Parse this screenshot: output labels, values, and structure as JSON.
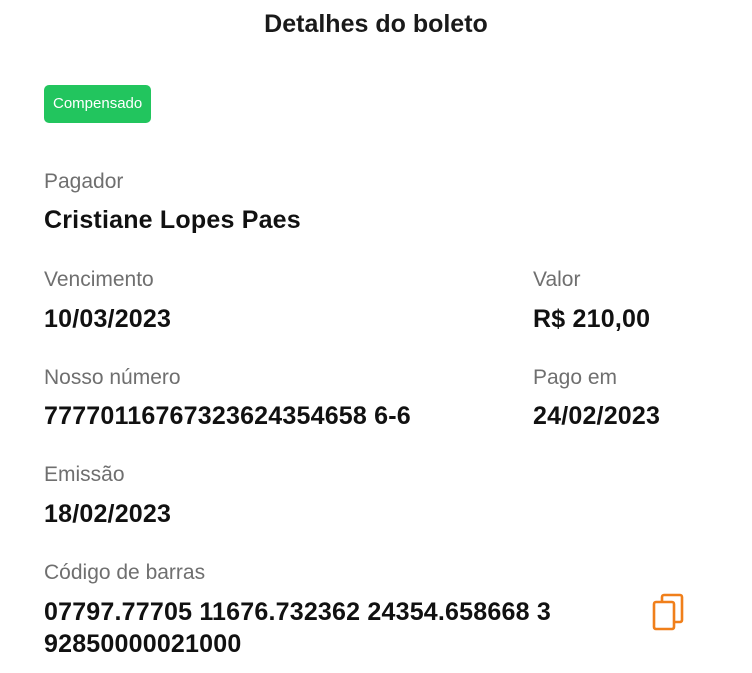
{
  "header": {
    "title": "Detalhes do boleto"
  },
  "status_badge": "Compensado",
  "fields": {
    "pagador": {
      "label": "Pagador",
      "value": "Cristiane Lopes Paes"
    },
    "vencimento": {
      "label": "Vencimento",
      "value": "10/03/2023"
    },
    "valor": {
      "label": "Valor",
      "value": "R$ 210,00"
    },
    "nosso_numero": {
      "label": "Nosso número",
      "value": "77770116767323624354658 6-6"
    },
    "pago_em": {
      "label": "Pago em",
      "value": "24/02/2023"
    },
    "emissao": {
      "label": "Emissão",
      "value": "18/02/2023"
    },
    "codigo_barras": {
      "label": "Código de barras",
      "value": "07797.77705 11676.732362 24354.658668 3 92850000021000"
    }
  },
  "icons": {
    "copy": "copy-icon"
  },
  "colors": {
    "badge": "#22c55e",
    "accent": "#f07f1a",
    "label": "#6f6f6f"
  }
}
